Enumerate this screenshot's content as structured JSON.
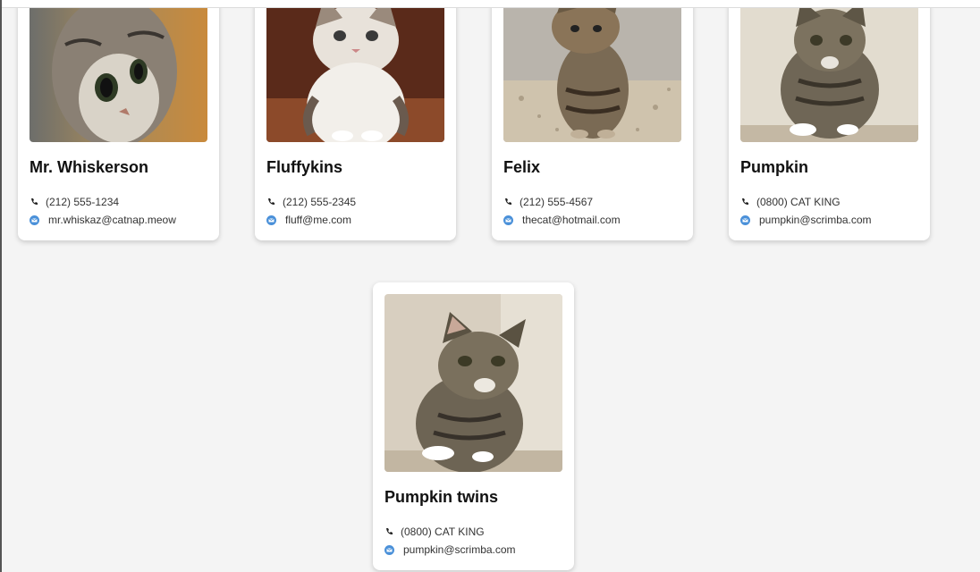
{
  "cats": [
    {
      "name": "Mr. Whiskerson",
      "phone": "(212) 555-1234",
      "email": "mr.whiskaz@catnap.meow"
    },
    {
      "name": "Fluffykins",
      "phone": "(212) 555-2345",
      "email": "fluff@me.com"
    },
    {
      "name": "Felix",
      "phone": "(212) 555-4567",
      "email": "thecat@hotmail.com"
    },
    {
      "name": "Pumpkin",
      "phone": "(0800) CAT KING",
      "email": "pumpkin@scrimba.com"
    },
    {
      "name": "Pumpkin twins",
      "phone": "(0800) CAT KING",
      "email": "pumpkin@scrimba.com"
    }
  ],
  "icons": {
    "phone": "phone-icon",
    "email": "email-icon"
  },
  "colors": {
    "background": "#f4f4f4",
    "card": "#ffffff",
    "email_icon": "#4a90d9"
  }
}
